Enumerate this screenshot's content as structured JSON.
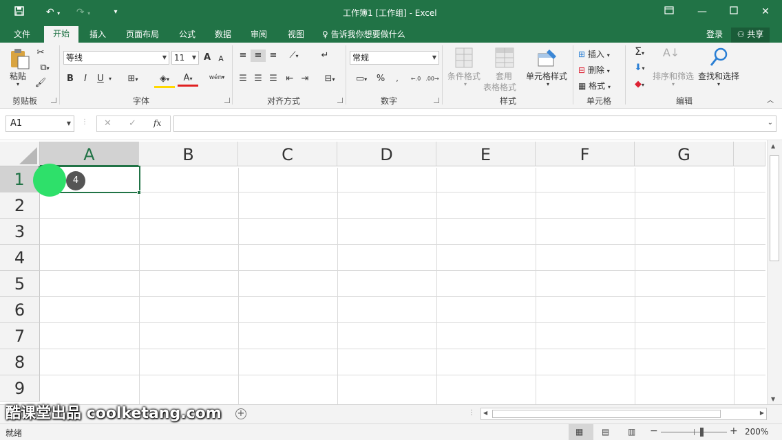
{
  "titlebar": {
    "title": "工作簿1  [工作组] - Excel"
  },
  "tabs": [
    {
      "label": "文件"
    },
    {
      "label": "开始"
    },
    {
      "label": "插入"
    },
    {
      "label": "页面布局"
    },
    {
      "label": "公式"
    },
    {
      "label": "数据"
    },
    {
      "label": "审阅"
    },
    {
      "label": "视图"
    }
  ],
  "tell_me": "告诉我你想要做什么",
  "account": {
    "login": "登录",
    "share": "共享"
  },
  "clipboard": {
    "paste": "粘贴",
    "label": "剪贴板"
  },
  "font": {
    "name": "等线",
    "size": "11",
    "label": "字体",
    "bold": "B",
    "italic": "I",
    "underline": "U",
    "grow": "A",
    "shrink": "A",
    "color": "A",
    "phonetic": "wén"
  },
  "alignment": {
    "label": "对齐方式"
  },
  "number": {
    "format": "常规",
    "label": "数字",
    "percent": "%"
  },
  "styles": {
    "conditional": "条件格式",
    "table_line1": "套用",
    "table_line2": "表格格式",
    "cell_styles": "单元格样式",
    "label": "样式"
  },
  "cells": {
    "insert": "插入",
    "delete": "删除",
    "format": "格式",
    "label": "单元格"
  },
  "editing": {
    "sort": "排序和筛选",
    "find": "查找和选择",
    "label": "编辑"
  },
  "formula_bar": {
    "name_box": "A1",
    "fx": "fx",
    "formula": ""
  },
  "columns": [
    "A",
    "B",
    "C",
    "D",
    "E",
    "F",
    "G"
  ],
  "rows": [
    "1",
    "2",
    "3",
    "4",
    "5",
    "6",
    "7",
    "8",
    "9"
  ],
  "selected_cell": "A1",
  "click_marker": "4",
  "watermark": "酷课堂出品 coolketang.com",
  "status": {
    "ready": "就绪",
    "zoom": "200%"
  },
  "colors": {
    "excel_green": "#217346",
    "marker_green": "#2ee06a"
  }
}
